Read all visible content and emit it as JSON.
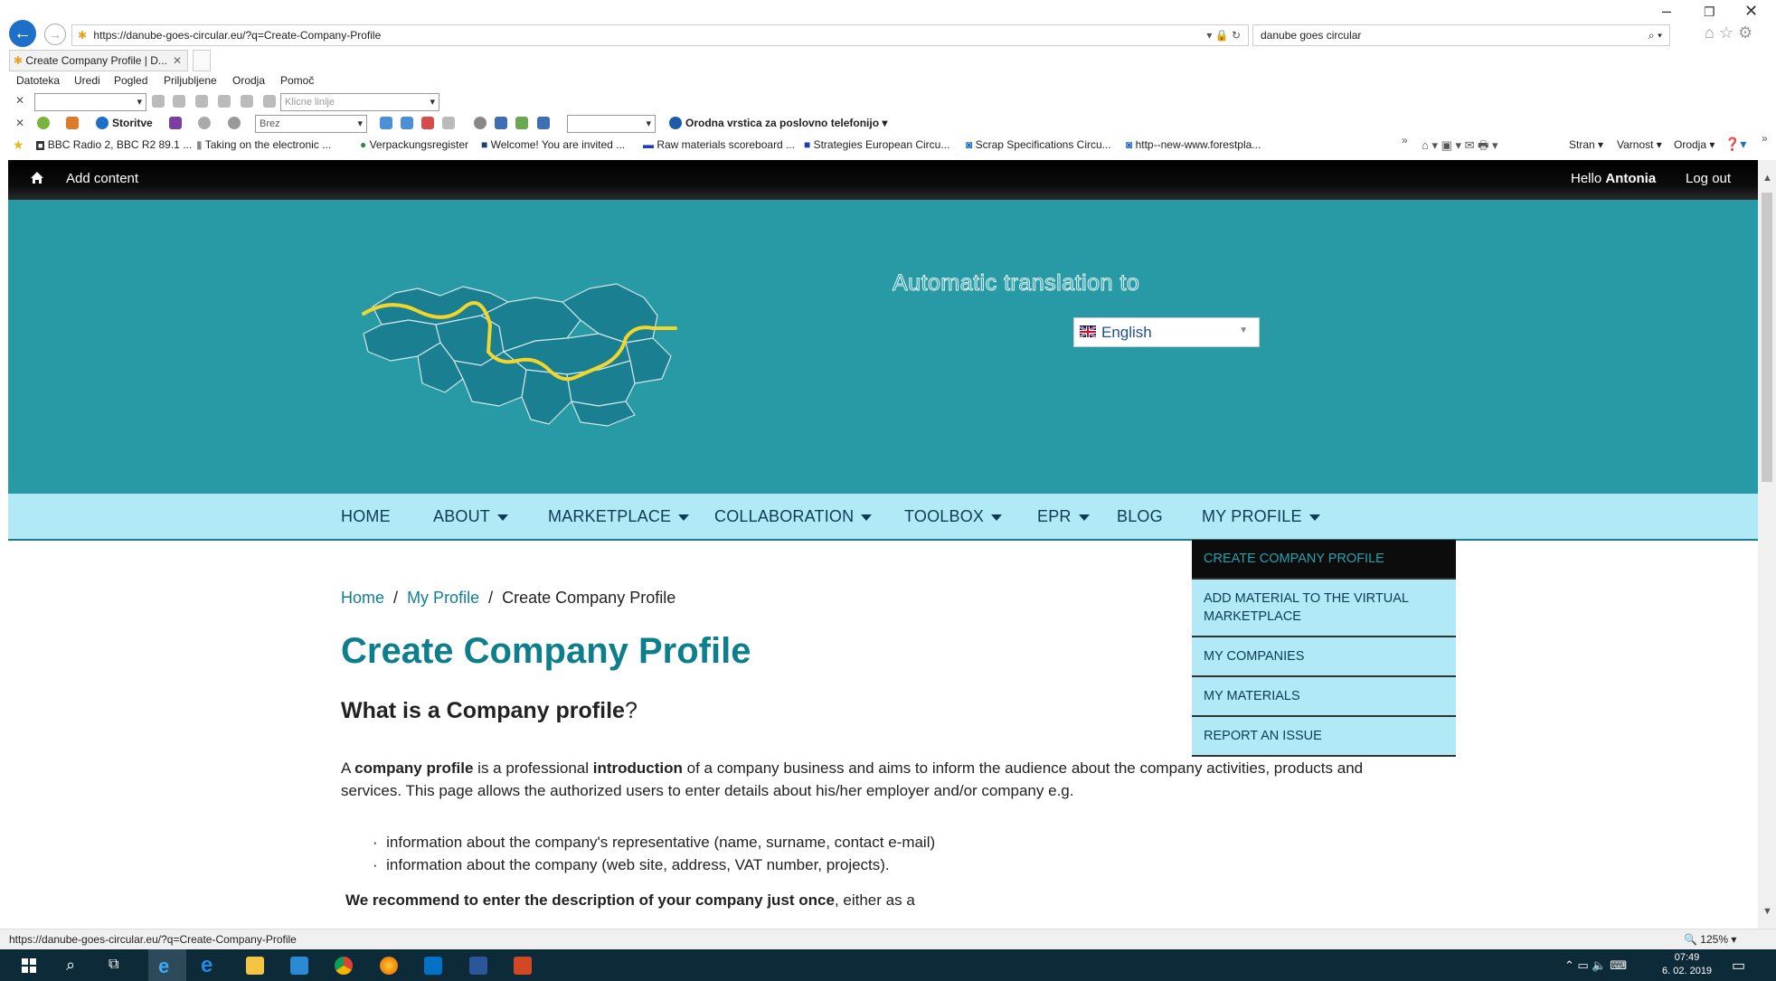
{
  "browser": {
    "url": "https://danube-goes-circular.eu/?q=Create-Company-Profile",
    "search_query": "danube goes circular",
    "tab_title": "Create Company Profile | D...",
    "menu": [
      "Datoteka",
      "Uredi",
      "Pogled",
      "Priljubljene",
      "Orodja",
      "Pomoč"
    ],
    "toolbar1_placeholder": "Klicne linije",
    "toolbar2": {
      "services": "Storitve",
      "combo": "Brez",
      "phone_bar": "Orodna vrstica za poslovno telefonijo"
    },
    "favorites": [
      "BBC Radio 2, BBC R2 89.1 ...",
      "Taking on the electronic ...",
      "Verpackungsregister",
      "Welcome! You are invited ...",
      "Raw materials scoreboard ...",
      "Strategies European Circu...",
      "Scrap Specifications Circu...",
      "http--new-www.forestpla..."
    ],
    "command_bar": [
      "Stran",
      "Varnost",
      "Orodja"
    ],
    "status_url": "https://danube-goes-circular.eu/?q=Create-Company-Profile",
    "zoom": "125%",
    "clock_time": "07:49",
    "clock_date": "6. 02. 2019"
  },
  "admin_bar": {
    "add_content": "Add content",
    "hello": "Hello",
    "user": "Antonia",
    "logout": "Log out"
  },
  "hero": {
    "translate_heading": "Automatic translation to",
    "language": "English",
    "map_colors": {
      "land": "#1b7f92",
      "river": "#f2d62a",
      "bg": "#279aa6"
    }
  },
  "nav": {
    "items": [
      {
        "label": "HOME",
        "has_caret": false
      },
      {
        "label": "ABOUT",
        "has_caret": true
      },
      {
        "label": "MARKETPLACE",
        "has_caret": true
      },
      {
        "label": "COLLABORATION",
        "has_caret": true
      },
      {
        "label": "TOOLBOX",
        "has_caret": true
      },
      {
        "label": "EPR",
        "has_caret": true
      },
      {
        "label": "BLOG",
        "has_caret": false
      },
      {
        "label": "MY PROFILE",
        "has_caret": true
      }
    ],
    "dropdown": [
      {
        "label": "CREATE COMPANY PROFILE",
        "active": true
      },
      {
        "label": "ADD MATERIAL TO THE VIRTUAL MARKETPLACE",
        "active": false
      },
      {
        "label": "MY COMPANIES",
        "active": false
      },
      {
        "label": "MY MATERIALS",
        "active": false
      },
      {
        "label": "REPORT AN ISSUE",
        "active": false
      }
    ]
  },
  "breadcrumb": {
    "home": "Home",
    "profile": "My Profile",
    "current": "Create Company Profile"
  },
  "page": {
    "title": "Create Company Profile",
    "subtitle": "What is a Company profile",
    "subtitle_q": "?",
    "para": {
      "a": "A ",
      "b1": "company profile",
      "t1": " is a professional ",
      "b2": "introduction",
      "t2": " of  a company business and aims to inform the audience about the company activities, products and services. This page allows the authorized users to enter details about his/her employer and/or company e.g."
    },
    "bullets": [
      "information about the company's representative (name, surname, contact e-mail)",
      "information about the company (web site, address, VAT number, projects)."
    ],
    "recommend_bold": "We recommend to enter the description of your company just once",
    "recommend_rest": ", either as a"
  }
}
